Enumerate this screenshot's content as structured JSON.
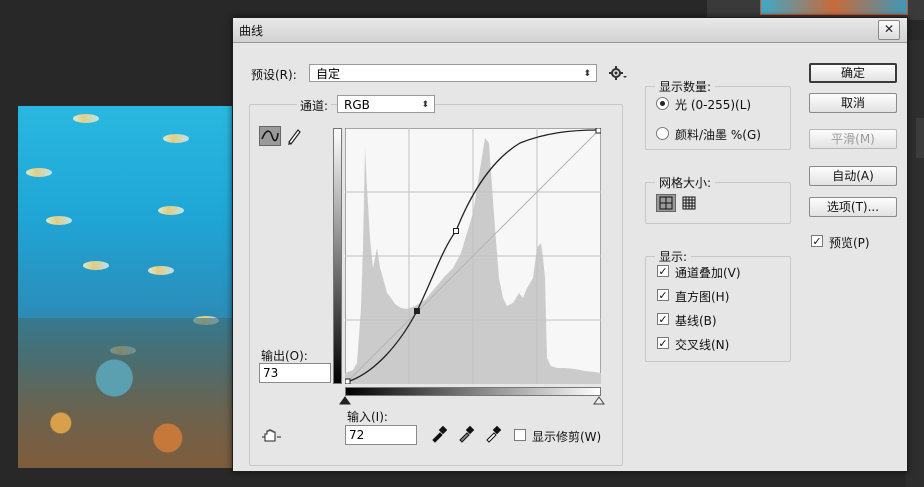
{
  "dialog": {
    "title": "曲线",
    "close_label": "✕"
  },
  "preset": {
    "label": "预设(R):",
    "value": "自定"
  },
  "channel": {
    "label": "通道:",
    "value": "RGB"
  },
  "output": {
    "label": "输出(O):",
    "value": "73"
  },
  "input": {
    "label": "输入(I):",
    "value": "72"
  },
  "show_clipping": {
    "label": "显示修剪(W)",
    "checked": false
  },
  "display_amount": {
    "title": "显示数量:",
    "options": [
      {
        "label": "光 (0-255)(L)",
        "selected": true
      },
      {
        "label": "颜料/油墨 %(G)",
        "selected": false
      }
    ]
  },
  "grid_size": {
    "title": "网格大小:"
  },
  "show": {
    "title": "显示:",
    "options": [
      {
        "label": "通道叠加(V)",
        "checked": true
      },
      {
        "label": "直方图(H)",
        "checked": true
      },
      {
        "label": "基线(B)",
        "checked": true
      },
      {
        "label": "交叉线(N)",
        "checked": true
      }
    ]
  },
  "buttons": {
    "ok": "确定",
    "cancel": "取消",
    "smooth": "平滑(M)",
    "auto": "自动(A)",
    "options": "选项(T)..."
  },
  "preview": {
    "label": "预览(P)",
    "checked": true
  },
  "icons": [
    "curve-tool-icon",
    "pencil-icon",
    "gear-icon",
    "grid-coarse-icon",
    "grid-fine-icon",
    "hand-target-icon",
    "black-eyedropper-icon",
    "gray-eyedropper-icon",
    "white-eyedropper-icon"
  ]
}
